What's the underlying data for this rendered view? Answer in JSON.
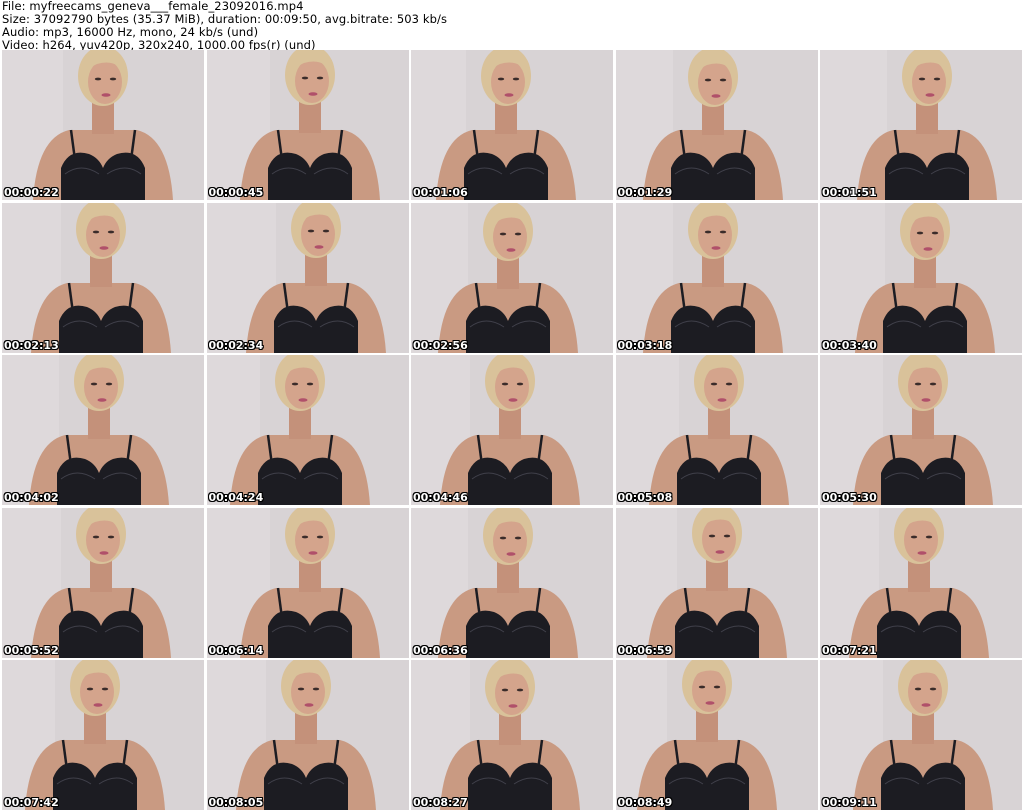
{
  "header": {
    "file_line": "File: myfreecams_geneva___female_23092016.mp4",
    "size_line": "Size: 37092790 bytes (35.37 MiB), duration: 00:09:50, avg.bitrate: 503 kb/s",
    "audio_line": "Audio: mp3, 16000 Hz, mono, 24 kb/s (und)",
    "video_line": "Video: h264, yuv420p, 320x240, 1000.00 fps(r) (und)"
  },
  "thumbnails": [
    {
      "timestamp": "00:00:22"
    },
    {
      "timestamp": "00:00:45"
    },
    {
      "timestamp": "00:01:06"
    },
    {
      "timestamp": "00:01:29"
    },
    {
      "timestamp": "00:01:51"
    },
    {
      "timestamp": "00:02:13"
    },
    {
      "timestamp": "00:02:34"
    },
    {
      "timestamp": "00:02:56"
    },
    {
      "timestamp": "00:03:18"
    },
    {
      "timestamp": "00:03:40"
    },
    {
      "timestamp": "00:04:02"
    },
    {
      "timestamp": "00:04:24"
    },
    {
      "timestamp": "00:04:46"
    },
    {
      "timestamp": "00:05:08"
    },
    {
      "timestamp": "00:05:30"
    },
    {
      "timestamp": "00:05:52"
    },
    {
      "timestamp": "00:06:14"
    },
    {
      "timestamp": "00:06:36"
    },
    {
      "timestamp": "00:06:59"
    },
    {
      "timestamp": "00:07:21"
    },
    {
      "timestamp": "00:07:42"
    },
    {
      "timestamp": "00:08:05"
    },
    {
      "timestamp": "00:08:27"
    },
    {
      "timestamp": "00:08:49"
    },
    {
      "timestamp": "00:09:11"
    }
  ],
  "colors": {
    "background": "#ffffff",
    "thumb_wall": "#d8d3d5",
    "skin": "#c99a82",
    "hair": "#d9c29a",
    "garment": "#1c1c22",
    "timestamp_text": "#ffffff"
  }
}
